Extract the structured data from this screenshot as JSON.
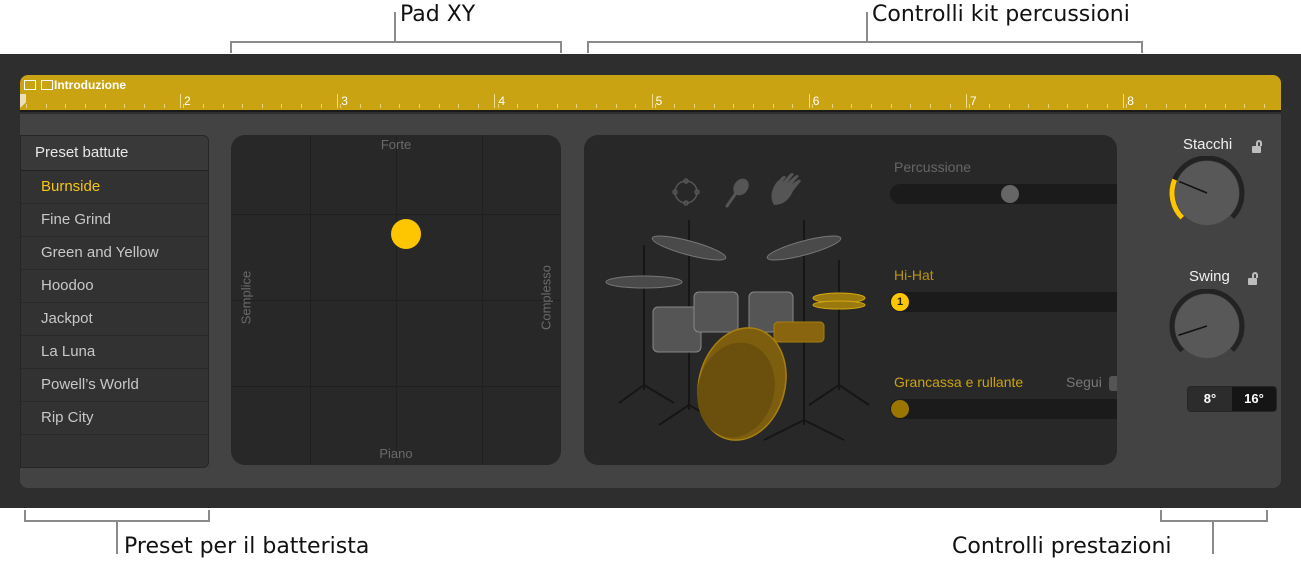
{
  "callouts": {
    "xy_pad": "Pad XY",
    "kit_controls": "Controlli kit percussioni",
    "drummer_presets": "Preset per il batterista",
    "performance_controls": "Controlli prestazioni"
  },
  "ruler": {
    "region_name": "Introduzione",
    "bar_numbers": [
      "2",
      "3",
      "4",
      "5",
      "6",
      "7",
      "8"
    ],
    "color": "#c9a312"
  },
  "presets": {
    "header": "Preset battute",
    "selected_index": 0,
    "items": [
      "Burnside",
      "Fine Grind",
      "Green and Yellow",
      "Hoodoo",
      "Jackpot",
      "La Luna",
      "Powell’s World",
      "Rip City"
    ]
  },
  "xy_pad": {
    "top_label": "Forte",
    "bottom_label": "Piano",
    "left_label": "Semplice",
    "right_label": "Complesso",
    "puck_x": 0.53,
    "puck_y": 0.7
  },
  "kit": {
    "icons": [
      "tambourine-icon",
      "maraca-icon",
      "handclap-icon"
    ],
    "percussion_label": "Percussione",
    "percussion_value": 0.5,
    "hihat_label": "Hi-Hat",
    "hihat_badge": "1",
    "hihat_value": 0.0,
    "kick_snare_label": "Grancassa e rullante",
    "kick_snare_value": 0.0,
    "follow_label": "Segui",
    "follow_checked": false,
    "accent_color": "#c9a312"
  },
  "performance": {
    "fills_label": "Stacchi",
    "fills_value": 0.25,
    "swing_label": "Swing",
    "swing_value": 0.1,
    "swing_options": [
      "8°",
      "16°"
    ],
    "swing_selected": "16°"
  }
}
